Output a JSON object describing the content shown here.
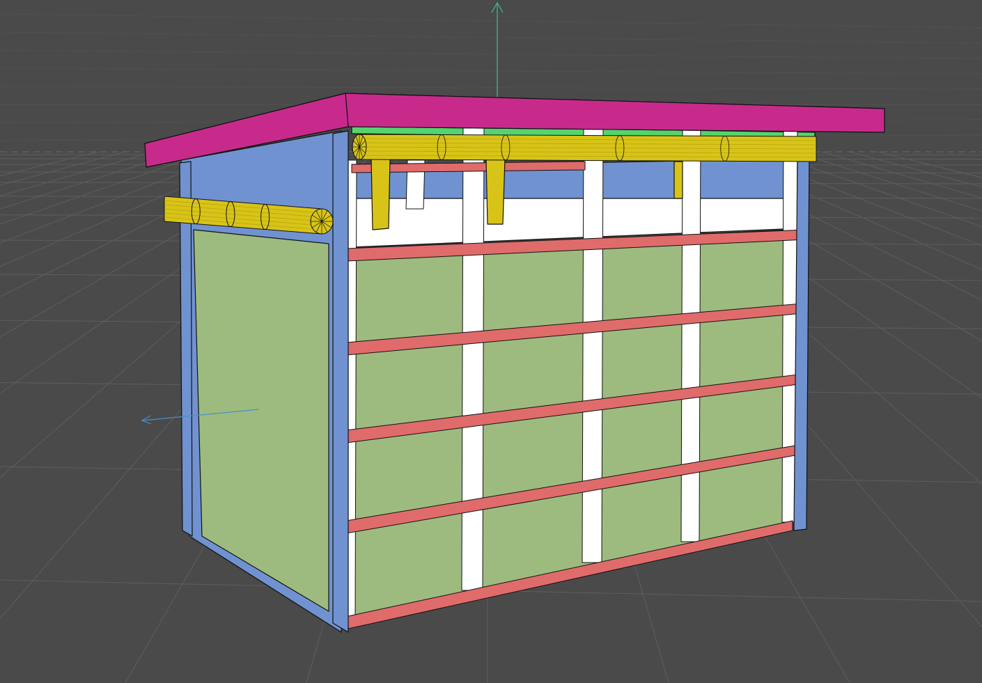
{
  "viewport": {
    "background": "#4a4a4a",
    "grid_color": "#5e5e5e",
    "axis_colors": {
      "y": "#3fbf8f",
      "x": "#4a90c8"
    }
  },
  "model": {
    "roof_color": "#d12f92",
    "roof_top_color": "#c82a8c",
    "end_wall_color": "#7092d0",
    "panel_color": "#9dbb7f",
    "stud_color": "#ffffff",
    "rail_color": "#e06b6b",
    "log_color": "#d8c418",
    "log_shade": "#b8a612",
    "green_gap": "#55d46e",
    "edge_color": "#111111"
  }
}
